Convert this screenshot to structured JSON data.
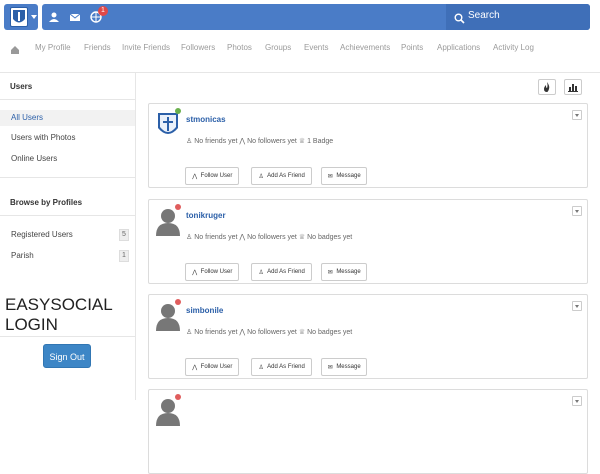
{
  "topbar": {
    "notification_count": "1",
    "search_label": "Search",
    "icons": [
      "logo-icon",
      "user-icon",
      "mail-icon",
      "globe-icon",
      "search-icon"
    ],
    "accent_color": "#4a7cc7"
  },
  "nav": {
    "items": [
      "My Profile",
      "Friends",
      "Invite Friends",
      "Followers",
      "Photos",
      "Groups",
      "Events",
      "Achievements",
      "Points",
      "Applications",
      "Activity Log"
    ]
  },
  "sidebar": {
    "users_title": "Users",
    "users_items": [
      {
        "label": "All Users",
        "active": true
      },
      {
        "label": "Users with Photos",
        "active": false
      },
      {
        "label": "Online Users",
        "active": false
      }
    ],
    "profiles_title": "Browse by Profiles",
    "profiles_items": [
      {
        "label": "Registered Users",
        "count": "5"
      },
      {
        "label": "Parish",
        "count": "1"
      }
    ],
    "login_title_line1": "EASYSOCIAL",
    "login_title_line2": "LOGIN",
    "sign_out_label": "Sign Out"
  },
  "users": [
    {
      "name": "stmonicas",
      "online": true,
      "friends_text": "No friends yet",
      "followers_text": "No followers yet",
      "badges_text": "1 Badge",
      "avatar_type": "logo"
    },
    {
      "name": "tonikruger",
      "online": false,
      "friends_text": "No friends yet",
      "followers_text": "No followers yet",
      "badges_text": "No badges yet",
      "avatar_type": "silhouette"
    },
    {
      "name": "simbonile",
      "online": false,
      "friends_text": "No friends yet",
      "followers_text": "No followers yet",
      "badges_text": "No badges yet",
      "avatar_type": "silhouette"
    }
  ],
  "card_buttons": {
    "follow": "Follow User",
    "add_friend": "Add As Friend",
    "message": "Message"
  },
  "colors": {
    "online": "#6ab04c",
    "offline": "#e05d5d",
    "link": "#2b5fa8"
  }
}
